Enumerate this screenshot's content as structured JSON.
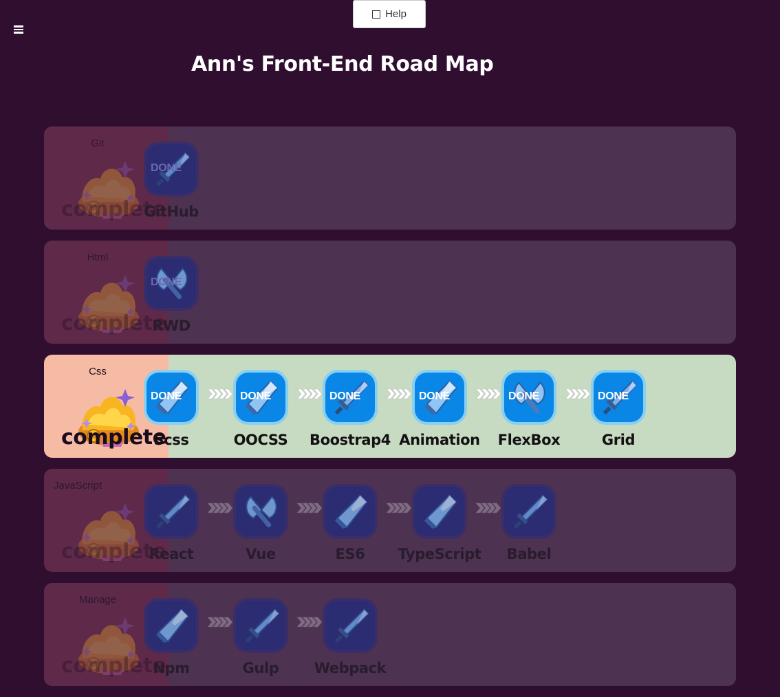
{
  "help_label": "Help",
  "title": "Ann's Front-End Road Map",
  "complete_label": "complete",
  "done_label": "DONE",
  "rows": [
    {
      "name": "Git",
      "active": false,
      "skills": [
        {
          "label": "GitHub",
          "done": true,
          "icon": "sword-icon"
        }
      ]
    },
    {
      "name": "Html",
      "active": false,
      "skills": [
        {
          "label": "RWD",
          "done": true,
          "icon": "axe-icon"
        }
      ]
    },
    {
      "name": "Css",
      "active": true,
      "skills": [
        {
          "label": "Scss",
          "done": true,
          "icon": "crystal-icon"
        },
        {
          "label": "OOCSS",
          "done": true,
          "icon": "crystal-icon"
        },
        {
          "label": "Boostrap4",
          "done": true,
          "icon": "sword-icon"
        },
        {
          "label": "Animation",
          "done": true,
          "icon": "crystal-icon"
        },
        {
          "label": "FlexBox",
          "done": true,
          "icon": "axe-icon"
        },
        {
          "label": "Grid",
          "done": true,
          "icon": "sword-icon"
        }
      ]
    },
    {
      "name": "JavaScript",
      "active": false,
      "skills": [
        {
          "label": "React",
          "done": false,
          "icon": "sword-icon"
        },
        {
          "label": "Vue",
          "done": false,
          "icon": "axe-icon"
        },
        {
          "label": "ES6",
          "done": false,
          "icon": "crystal-icon"
        },
        {
          "label": "TypeScript",
          "done": false,
          "icon": "crystal-icon"
        },
        {
          "label": "Babel",
          "done": false,
          "icon": "sword-icon"
        }
      ]
    },
    {
      "name": "Manage",
      "active": false,
      "skills": [
        {
          "label": "Npm",
          "done": false,
          "icon": "crystal-icon"
        },
        {
          "label": "Gulp",
          "done": false,
          "icon": "sword-icon"
        },
        {
          "label": "Webpack",
          "done": false,
          "icon": "sword-icon"
        }
      ]
    }
  ],
  "colors": {
    "background": "#2f0e30",
    "active_left": "#f6bba4",
    "active_right": "#c6dbc1",
    "badge_blue": "#0a86e6",
    "badge_ring": "#87d0f2"
  }
}
